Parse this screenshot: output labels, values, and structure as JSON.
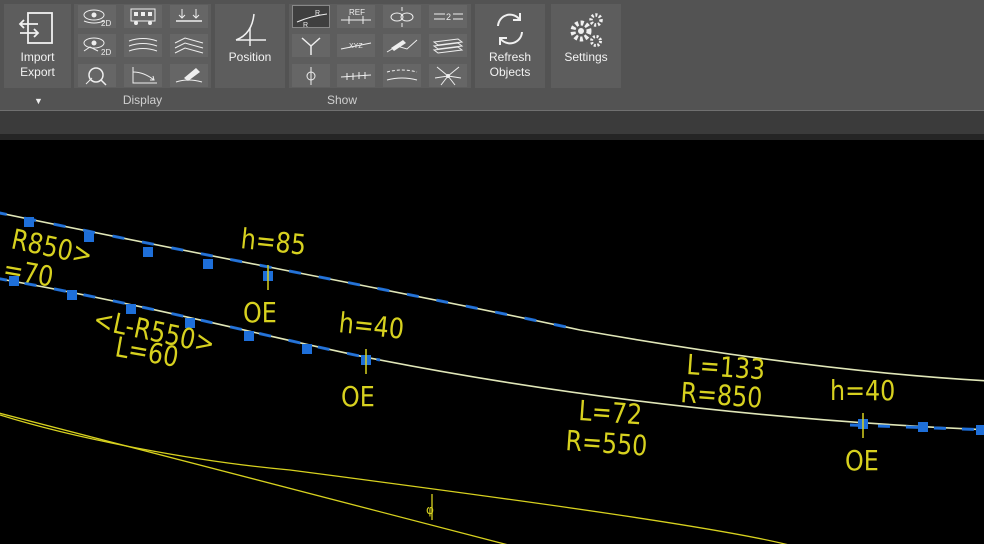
{
  "ribbon": {
    "import_export": {
      "label_line1": "Import",
      "label_line2": "Export",
      "icon": "import-export-icon"
    },
    "display_group": {
      "label": "Display",
      "tools": [
        "2d-eye-icon",
        "bus-icon",
        "level-arrows-icon",
        "2d-eye-alt-icon",
        "layers-wave-icon",
        "terrain-layers-icon",
        "zoom-circle-icon",
        "curve-axis-icon",
        "pen-surface-icon"
      ],
      "texts": {
        "t1": "2D",
        "t2": "2D"
      }
    },
    "position": {
      "label": "Position",
      "icon": "position-axis-icon"
    },
    "show_group": {
      "label": "Show",
      "tools": [
        "radius-curve-icon",
        "ref-line-icon",
        "chain-link-icon",
        "equals-2-icon",
        "y-branch-icon",
        "xyz-line-icon",
        "survey-pen-icon",
        "stack-layers-icon",
        "phi-marker-icon",
        "ticked-line-icon",
        "dashed-curve-icon",
        "star-network-icon"
      ],
      "texts": {
        "r": "R",
        "ref": "REF",
        "xyz": "XYZ",
        "two": "2"
      }
    },
    "refresh": {
      "label_line1": "Refresh",
      "label_line2": "Objects",
      "icon": "refresh-icon"
    },
    "settings": {
      "label": "Settings",
      "icon": "gears-icon"
    }
  },
  "drawing": {
    "colors": {
      "background": "#000000",
      "annotation": "#d7d11f",
      "track_line": "#e0e6b8",
      "marker": "#1e6fd9"
    },
    "labels": {
      "r850_top": "R850>",
      "eq70": "=70",
      "h85": "h=85",
      "oe1": "OE",
      "l_r550": "<L-R550>",
      "l60": "L=60",
      "h40_a": "h=40",
      "oe2": "OE",
      "l133": "L=133",
      "r850": "R=850",
      "l72": "L=72",
      "r550": "R=550",
      "h40_b": "h=40",
      "oe3": "OE",
      "phi": "φ"
    }
  }
}
